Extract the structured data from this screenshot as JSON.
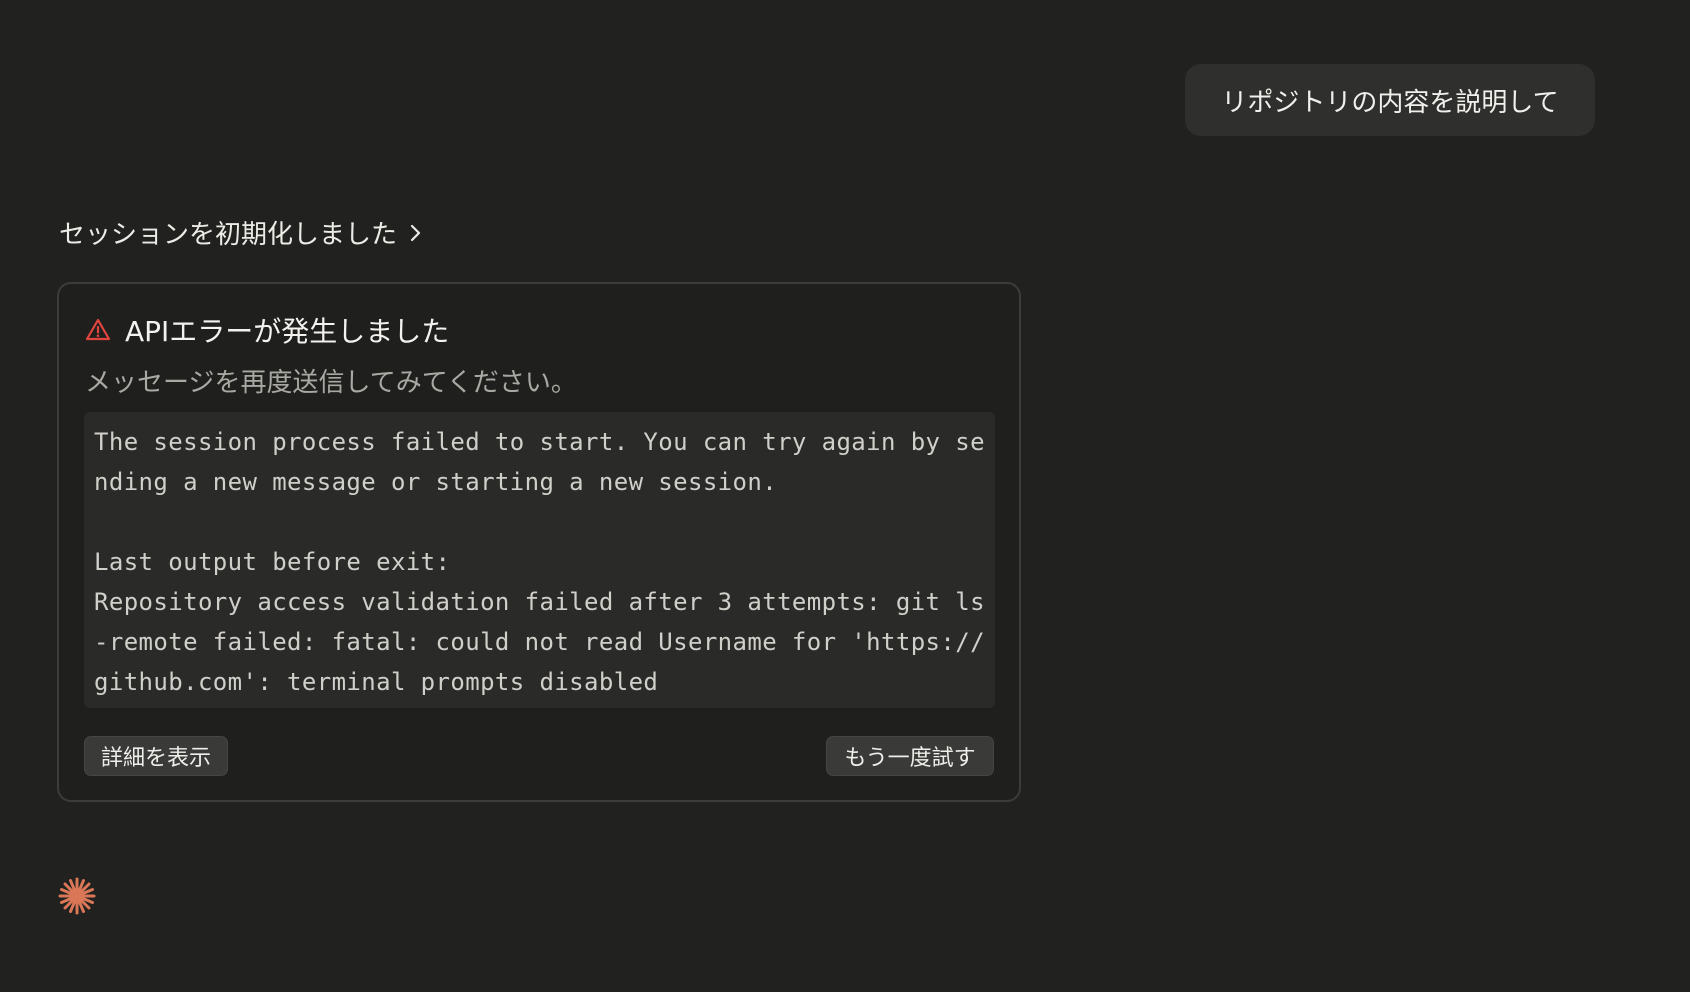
{
  "user_message": {
    "text": "リポジトリの内容を説明して"
  },
  "session_status": {
    "label": "セッションを初期化しました",
    "icon": "chevron-right-icon"
  },
  "error": {
    "icon": "warning-triangle-icon",
    "title": "APIエラーが発生しました",
    "hint": "メッセージを再度送信してみてください。",
    "log": "The session process failed to start. You can try again by sending a new message or starting a new session.\n\nLast output before exit:\nRepository access validation failed after 3 attempts: git ls-remote failed: fatal: could not read Username for 'https://github.com': terminal prompts disabled",
    "details_button": "詳細を表示",
    "retry_button": "もう一度試す"
  },
  "assistant_indicator": {
    "icon": "sparkle-icon"
  },
  "colors": {
    "background": "#212120",
    "error_icon": "#e0443e",
    "accent": "#d97757"
  }
}
